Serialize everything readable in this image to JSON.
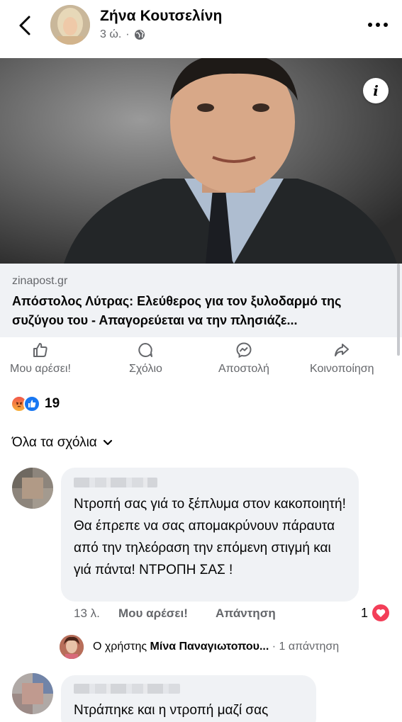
{
  "header": {
    "author": "Ζήνα Κουτσελίνη",
    "time": "3 ώ.",
    "privacy_icon": "globe-icon"
  },
  "post": {
    "link": {
      "domain": "zinapost.gr",
      "headline": "Απόστολος Λύτρας: Ελεύθερος για τον ξυλοδαρμό της συζύγου του - Απαγορεύεται να την πλησιάζε..."
    },
    "info_icon": "i"
  },
  "actions": {
    "like": "Μου αρέσει!",
    "comment": "Σχόλιο",
    "send": "Αποστολή",
    "share": "Κοινοποίηση"
  },
  "reactions": {
    "types": [
      "angry",
      "like"
    ],
    "count": "19"
  },
  "comments_filter": "Όλα τα σχόλια",
  "comments": [
    {
      "text": "Ντροπή σας γιά το ξέπλυμα στον κακοποιητή! Θα έπρεπε να σας απομακρύνουν πάραυτα από την τηλεόραση την επόμενη στιγμή και γιά πάντα! ΝΤΡΟΠΗ ΣΑΣ !",
      "time": "13 λ.",
      "like_label": "Μου αρέσει!",
      "reply_label": "Απάντηση",
      "reaction_count": "1",
      "reply_preview": {
        "prefix": "Ο χρήστης ",
        "name": "Μίνα Παναγιωτοπου...",
        "suffix": " · 1 απάντηση"
      }
    },
    {
      "text": "Ντράπηκε και η ντροπή μαζί σας"
    }
  ],
  "colors": {
    "secondary_text": "#65676b",
    "bubble": "#f0f2f5",
    "accent": "#1877f2",
    "heart": "#f33e58"
  }
}
